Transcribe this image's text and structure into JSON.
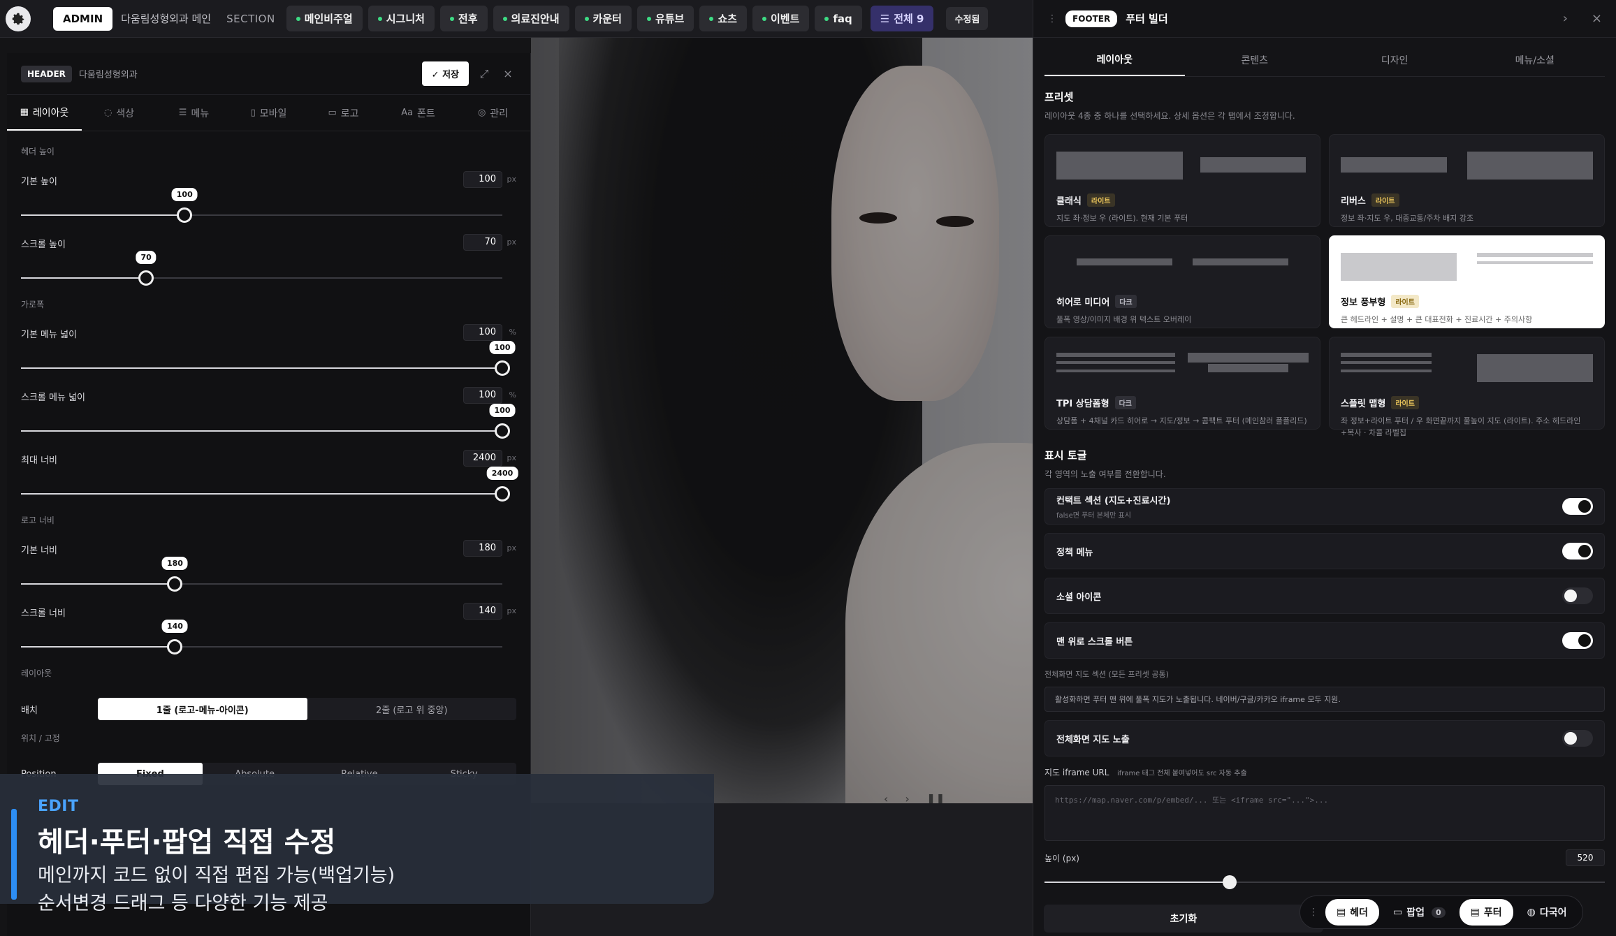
{
  "topbar": {
    "admin_label": "ADMIN",
    "site_name": "다움림성형외과 메인",
    "section_label": "SECTION",
    "sections": [
      "메인비주얼",
      "시그니처",
      "전후",
      "의료진안내",
      "카운터",
      "유튜브",
      "쇼츠",
      "이벤트",
      "faq"
    ],
    "all_label": "전체 9",
    "modify_label": "수정됨"
  },
  "header_panel": {
    "tag": "HEADER",
    "title": "다움림성형외과",
    "save_label": "✓ 저장",
    "tabs": [
      "레이아웃",
      "색상",
      "메뉴",
      "모바일",
      "로고",
      "폰트",
      "관리"
    ],
    "groups": {
      "height": "헤더 높이",
      "width": "가로폭",
      "logo": "로고 너비",
      "layout": "레이아웃",
      "position": "위치 / 고정"
    },
    "fields": [
      {
        "label": "기본 높이",
        "value": "100",
        "unit": "px",
        "pct": 0.34
      },
      {
        "label": "스크롤 높이",
        "value": "70",
        "unit": "px",
        "pct": 0.26
      },
      {
        "label": "기본 메뉴 넓이",
        "value": "100",
        "unit": "%",
        "pct": 1.0
      },
      {
        "label": "스크롤 메뉴 넓이",
        "value": "100",
        "unit": "%",
        "pct": 1.0
      },
      {
        "label": "최대 너비",
        "value": "2400",
        "unit": "px",
        "pct": 1.0
      },
      {
        "label": "기본 너비",
        "value": "180",
        "unit": "px",
        "pct": 0.32
      },
      {
        "label": "스크롤 너비",
        "value": "140",
        "unit": "px",
        "pct": 0.32
      }
    ],
    "arrangement_label": "배치",
    "arrangement_options": [
      "1줄 (로고-메뉴-아이콘)",
      "2줄 (로고 위 중앙)"
    ],
    "position_label": "Position",
    "position_options": [
      "Fixed",
      "Absolute",
      "Relative",
      "Sticky"
    ]
  },
  "footer_panel": {
    "tag": "FOOTER",
    "title": "푸터 빌더",
    "tabs": [
      "레이아웃",
      "콘텐츠",
      "디자인",
      "메뉴/소셜"
    ],
    "preset_title": "프리셋",
    "preset_desc": "레이아웃 4종 중 하나를 선택하세요. 상세 옵션은 각 탭에서 조정합니다.",
    "presets": [
      {
        "name": "클래식",
        "badge": "라이트",
        "badge_type": "lite",
        "desc": "지도 좌·정보 우 (라이트). 현재 기본 푸터"
      },
      {
        "name": "리버스",
        "badge": "라이트",
        "badge_type": "lite",
        "desc": "정보 좌·지도 우, 대중교통/주차 배지 강조"
      },
      {
        "name": "히어로 미디어",
        "badge": "다크",
        "badge_type": "dark",
        "desc": "풀폭 영상/이미지 배경 위 텍스트 오버레이"
      },
      {
        "name": "정보 풍부형",
        "badge": "라이트",
        "badge_type": "lite",
        "desc": "큰 헤드라인 + 설명 + 큰 대표전화 + 진료시간 + 주의사항"
      },
      {
        "name": "TPI 상담폼형",
        "badge": "다크",
        "badge_type": "dark",
        "desc": "상담폼 + 4채널 카드 히어로 → 지도/정보 → 콤팩트 푸터 (메인참러 플플리드)"
      },
      {
        "name": "스플릿 맵형",
        "badge": "라이트",
        "badge_type": "lite",
        "desc": "좌 정보+라이트 푸터 / 우 화면끝까지 풀높이 지도 (라이트). 주소 헤드라인+복사 · 차콜 라벨칩"
      }
    ],
    "toggle_title": "표시 토글",
    "toggle_desc": "각 영역의 노출 여부를 전환합니다.",
    "toggles": [
      {
        "label": "컨택트 섹션 (지도+진료시간)",
        "sub": "false면 푸터 본체만 표시",
        "on": true
      },
      {
        "label": "정책 메뉴",
        "sub": "",
        "on": true
      },
      {
        "label": "소셜 아이콘",
        "sub": "",
        "on": false
      },
      {
        "label": "맨 위로 스크롤 버튼",
        "sub": "",
        "on": true
      }
    ],
    "map_section_note": "전체화면 지도 섹션 (모든 프리셋 공통)",
    "map_info": "활성화하면 푸터 맨 위에 풀폭 지도가 노출됩니다. 네이버/구글/카카오 iframe 모두 지원.",
    "map_toggle": {
      "label": "전체화면 지도 노출",
      "on": false
    },
    "iframe_label": "지도 iframe URL",
    "iframe_hint": "iframe 태그 전체 붙여넣어도 src 자동 추출",
    "iframe_placeholder": "https://map.naver.com/p/embed/... 또는 <iframe src=\"...\">...",
    "height_label": "높이 (px)",
    "height_value": "520",
    "height_pct": 0.33,
    "reset_label": "초기화"
  },
  "dock": {
    "items": [
      {
        "label": "헤더",
        "on": true
      },
      {
        "label": "팝업",
        "on": false,
        "count": "0"
      },
      {
        "label": "푸터",
        "on": true
      },
      {
        "label": "다국어",
        "on": false
      }
    ]
  },
  "promo": {
    "kicker": "EDIT",
    "title": "헤더·푸터·팝업 직접 수정",
    "line1": "메인까지 코드 없이 직접 편집 가능(백업기능)",
    "line2": "순서변경 드래그 등 다양한 기능 제공"
  },
  "colors": {
    "accent": "#2d8ef4",
    "status_dot": "#3ddc84",
    "panel_bg": "#111113"
  }
}
